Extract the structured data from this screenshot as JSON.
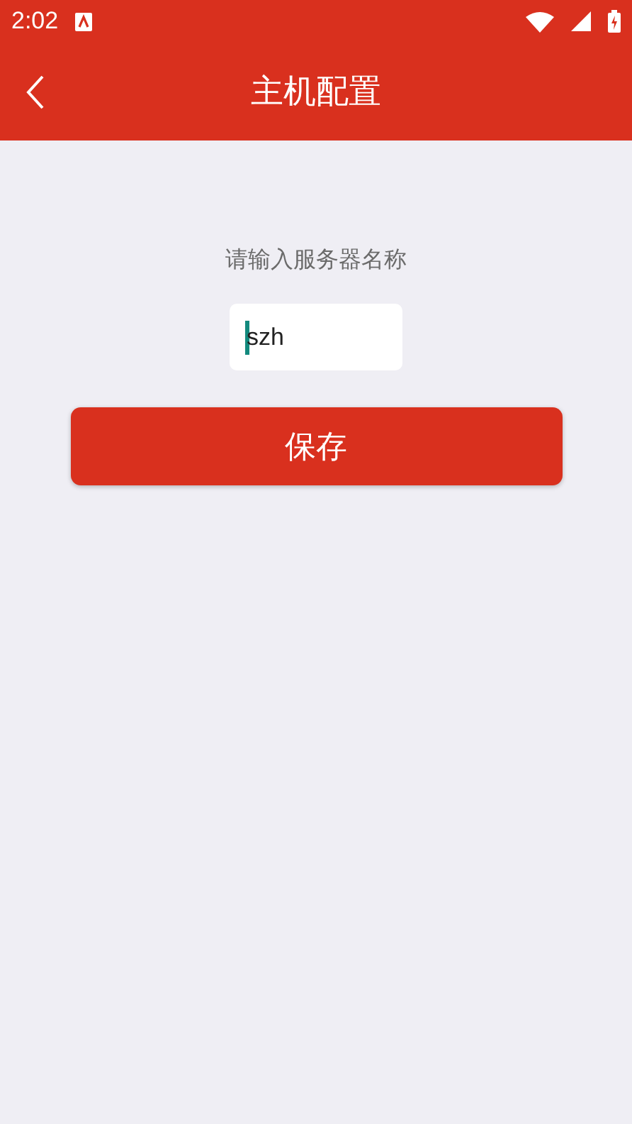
{
  "status_bar": {
    "time": "2:02"
  },
  "app_bar": {
    "title": "主机配置"
  },
  "form": {
    "label": "请输入服务器名称",
    "field": {
      "value": "szh",
      "focused": true
    },
    "button": "保存"
  }
}
